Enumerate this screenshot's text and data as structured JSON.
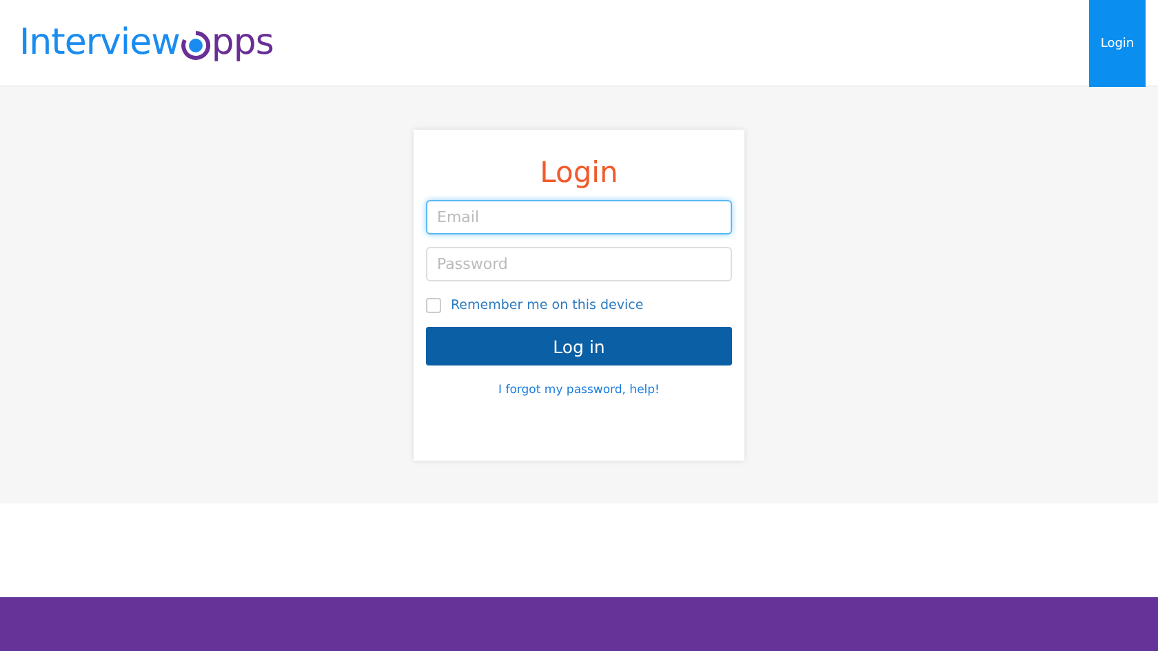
{
  "header": {
    "logo": {
      "part_1": "Interview",
      "part_2": "pps"
    },
    "login_button": "Login"
  },
  "login_card": {
    "title": "Login",
    "fields": [
      {
        "placeholder": "Email",
        "focused": true
      },
      {
        "placeholder": "Password",
        "focused": false
      }
    ],
    "remember": {
      "label": "Remember me on this device",
      "checked": false
    },
    "submit": "Log in",
    "forgot_link": "I forgot my password, help!"
  }
}
